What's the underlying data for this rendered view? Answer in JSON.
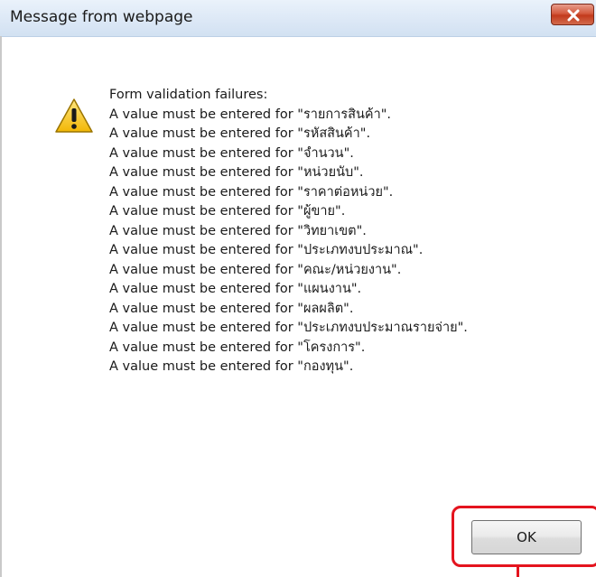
{
  "window": {
    "title": "Message from webpage"
  },
  "icons": {
    "warning": "warning-triangle",
    "close": "close-x"
  },
  "colors": {
    "close_button": "#c8452a",
    "highlight_box": "#e4141e",
    "title_bar": "#dfeaf7"
  },
  "message": {
    "header": "Form validation failures:",
    "lines": [
      {
        "prefix": "A value must be entered for ",
        "field": "\"รายการสินค้า\"",
        "suffix": "."
      },
      {
        "prefix": "A value must be entered for ",
        "field": "\"รหัสสินค้า\"",
        "suffix": "."
      },
      {
        "prefix": "A value must be entered for ",
        "field": "\"จำนวน\"",
        "suffix": "."
      },
      {
        "prefix": "A value must be entered for ",
        "field": "\"หน่วยนับ\"",
        "suffix": "."
      },
      {
        "prefix": "A value must be entered for ",
        "field": "\"ราคาต่อหน่วย\"",
        "suffix": "."
      },
      {
        "prefix": "A value must be entered for ",
        "field": "\"ผู้ขาย\"",
        "suffix": "."
      },
      {
        "prefix": "A value must be entered for ",
        "field": "\"วิทยาเขต\"",
        "suffix": "."
      },
      {
        "prefix": "A value must be entered for ",
        "field": "\"ประเภทงบประมาณ\"",
        "suffix": "."
      },
      {
        "prefix": "A value must be entered for ",
        "field": "\"คณะ/หน่วยงาน\"",
        "suffix": "."
      },
      {
        "prefix": "A value must be entered for ",
        "field": "\"แผนงาน\"",
        "suffix": "."
      },
      {
        "prefix": "A value must be entered for ",
        "field": "\"ผลผลิต\"",
        "suffix": "."
      },
      {
        "prefix": "A value must be entered for ",
        "field": "\"ประเภทงบประมาณรายจ่าย\"",
        "suffix": "."
      },
      {
        "prefix": "A value must be entered for ",
        "field": "\"โครงการ\"",
        "suffix": "."
      },
      {
        "prefix": "A value must be entered for ",
        "field": "\"กองทุน\"",
        "suffix": "."
      }
    ]
  },
  "buttons": {
    "ok_label": "OK"
  }
}
